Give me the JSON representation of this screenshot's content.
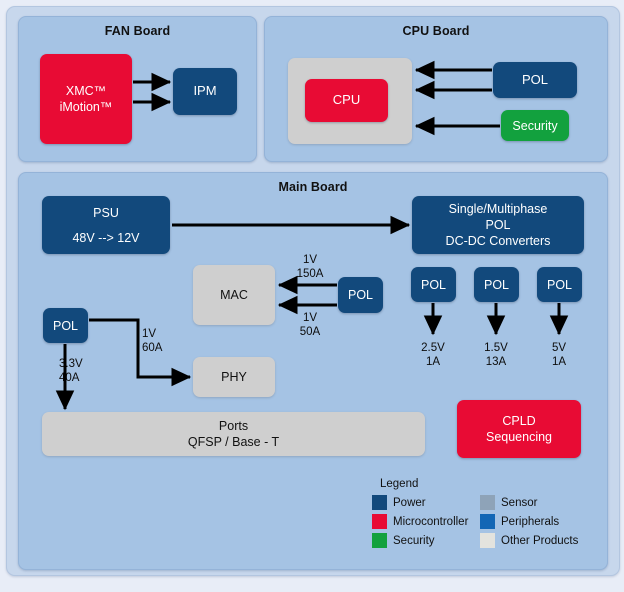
{
  "diagram": {
    "boards": {
      "fan": {
        "title": "FAN Board",
        "blocks": {
          "xmc": {
            "line1": "XMC™",
            "line2": "iMotion™",
            "type": "Microcontroller"
          },
          "ipm": {
            "label": "IPM",
            "type": "Power"
          }
        }
      },
      "cpu": {
        "title": "CPU Board",
        "blocks": {
          "carrier": {
            "label": "",
            "type": "Other Products"
          },
          "cpu": {
            "label": "CPU",
            "type": "Microcontroller"
          },
          "pol": {
            "label": "POL",
            "type": "Power"
          },
          "security": {
            "label": "Security",
            "type": "Security"
          }
        }
      },
      "main": {
        "title": "Main Board",
        "blocks": {
          "psu": {
            "line1": "PSU",
            "line2": "48V --> 12V",
            "type": "Power"
          },
          "multiphase": {
            "line1": "Single/Multiphase",
            "line2": "POL",
            "line3": "DC-DC Converters",
            "type": "Power"
          },
          "mac": {
            "label": "MAC",
            "type": "Other Products"
          },
          "phy": {
            "label": "PHY",
            "type": "Other Products"
          },
          "pol_mac": {
            "label": "POL",
            "type": "Power"
          },
          "pol_left": {
            "label": "POL",
            "type": "Power"
          },
          "pol_r1": {
            "label": "POL",
            "type": "Power"
          },
          "pol_r2": {
            "label": "POL",
            "type": "Power"
          },
          "pol_r3": {
            "label": "POL",
            "type": "Power"
          },
          "ports": {
            "line1": "Ports",
            "line2": "QFSP / Base - T",
            "type": "Other Products"
          },
          "cpld": {
            "line1": "CPLD",
            "line2": "Sequencing",
            "type": "Microcontroller"
          }
        },
        "rail_labels": {
          "mac_top": "1V\n150A",
          "mac_bottom": "1V\n50A",
          "pol_left_down": "3.3V\n40A",
          "pol_left_right": "1V\n60A",
          "pol_r1_out": "2.5V\n1A",
          "pol_r2_out": "1.5V\n13A",
          "pol_r3_out": "5V\n1A"
        }
      }
    },
    "legend": {
      "title": "Legend",
      "items": [
        {
          "label": "Power",
          "color": "#12497c"
        },
        {
          "label": "Sensor",
          "color": "#8ea3b8"
        },
        {
          "label": "Microcontroller",
          "color": "#e80b34"
        },
        {
          "label": "Peripherals",
          "color": "#1266b5"
        },
        {
          "label": "Security",
          "color": "#12a13e"
        },
        {
          "label": "Other Products",
          "color": "#e3e3de"
        }
      ]
    },
    "colors": {
      "page_background": "#e8edf7",
      "outer_panel": "#c7d7ec",
      "board_panel": "#a5c3e4",
      "arrow": "#000000"
    }
  }
}
